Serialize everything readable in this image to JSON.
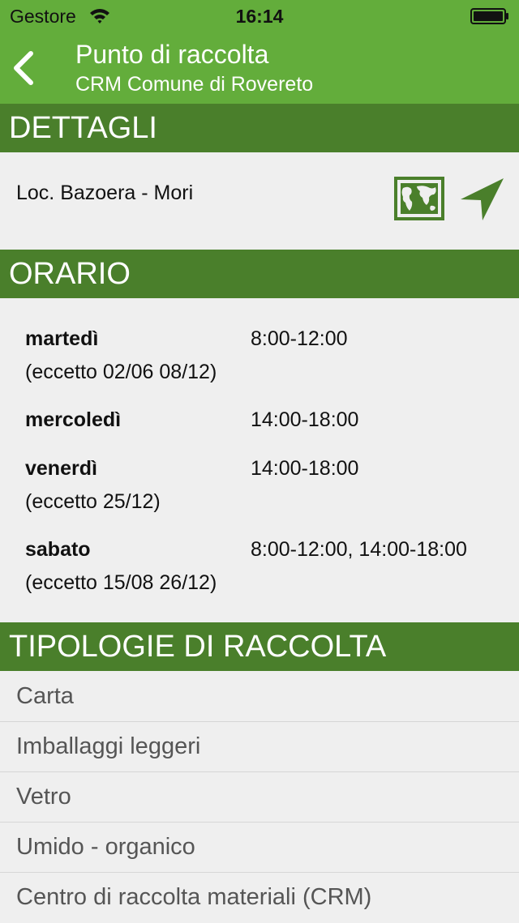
{
  "status_bar": {
    "carrier": "Gestore",
    "time": "16:14"
  },
  "nav": {
    "title": "Punto di raccolta",
    "subtitle": "CRM Comune di Rovereto"
  },
  "sections": {
    "details": "DETTAGLI",
    "hours": "ORARIO",
    "types": "TIPOLOGIE DI RACCOLTA"
  },
  "details": {
    "address": "Loc. Bazoera - Mori"
  },
  "schedule": [
    {
      "day": "martedì",
      "hours": "8:00-12:00",
      "exception": "(eccetto 02/06 08/12)"
    },
    {
      "day": "mercoledì",
      "hours": "14:00-18:00",
      "exception": ""
    },
    {
      "day": "venerdì",
      "hours": "14:00-18:00",
      "exception": "(eccetto 25/12)"
    },
    {
      "day": "sabato",
      "hours": "8:00-12:00, 14:00-18:00",
      "exception": "(eccetto 15/08 26/12)"
    }
  ],
  "types": [
    "Carta",
    "Imballaggi leggeri",
    "Vetro",
    "Umido - organico",
    "Centro di raccolta materiali (CRM)"
  ],
  "colors": {
    "nav_green": "#63ad3b",
    "header_green": "#4a7f2b",
    "icon_green": "#4a7f2b"
  }
}
